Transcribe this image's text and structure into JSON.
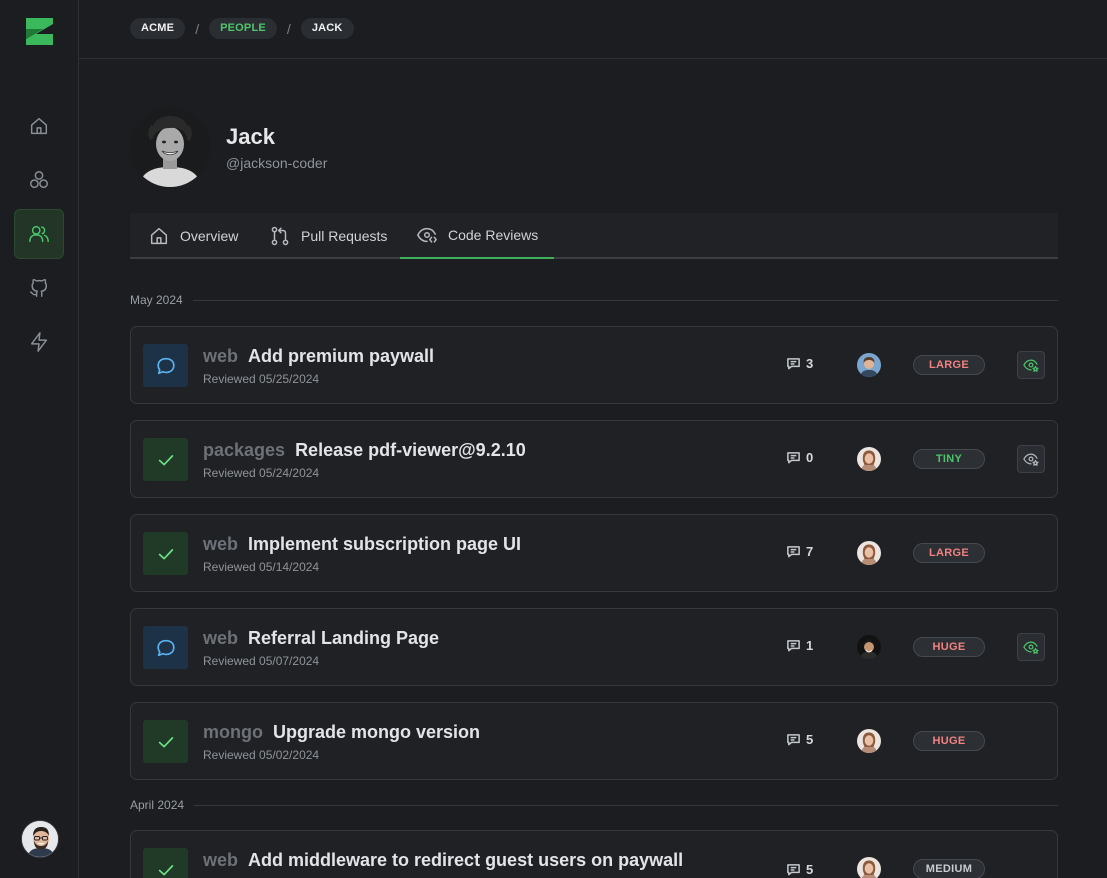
{
  "breadcrumb": [
    {
      "label": "ACME",
      "accent": false
    },
    {
      "label": "PEOPLE",
      "accent": true
    },
    {
      "label": "JACK",
      "accent": false
    }
  ],
  "breadcrumb_separator": "/",
  "profile": {
    "name": "Jack",
    "handle": "@jackson-coder"
  },
  "tabs": [
    {
      "label": "Overview",
      "icon": "home-icon",
      "active": false
    },
    {
      "label": "Pull Requests",
      "icon": "git-pull-request-icon",
      "active": false
    },
    {
      "label": "Code Reviews",
      "icon": "eye-code-icon",
      "active": true
    }
  ],
  "sidebar": {
    "items": [
      {
        "icon": "home-icon",
        "active": false
      },
      {
        "icon": "teams-icon",
        "active": false
      },
      {
        "icon": "people-icon",
        "active": true
      },
      {
        "icon": "github-icon",
        "active": false
      },
      {
        "icon": "lightning-icon",
        "active": false
      }
    ]
  },
  "months": [
    "May 2024",
    "April 2024"
  ],
  "reviews": [
    {
      "status": "commented",
      "repo": "web",
      "title": "Add premium paywall",
      "reviewed": "Reviewed 05/25/2024",
      "comments": "3",
      "size": "LARGE",
      "size_color": "#f08282",
      "watch": "active"
    },
    {
      "status": "approved",
      "repo": "packages",
      "title": "Release pdf-viewer@9.2.10",
      "reviewed": "Reviewed 05/24/2024",
      "comments": "0",
      "size": "TINY",
      "size_color": "#4cc76b",
      "watch": "inactive"
    },
    {
      "status": "approved",
      "repo": "web",
      "title": "Implement subscription page UI",
      "reviewed": "Reviewed 05/14/2024",
      "comments": "7",
      "size": "LARGE",
      "size_color": "#f08282",
      "watch": "none"
    },
    {
      "status": "commented",
      "repo": "web",
      "title": "Referral Landing Page",
      "reviewed": "Reviewed 05/07/2024",
      "comments": "1",
      "size": "HUGE",
      "size_color": "#f08282",
      "watch": "active"
    },
    {
      "status": "approved",
      "repo": "mongo",
      "title": "Upgrade mongo version",
      "reviewed": "Reviewed 05/02/2024",
      "comments": "5",
      "size": "HUGE",
      "size_color": "#f08282",
      "watch": "none"
    },
    {
      "status": "approved",
      "repo": "web",
      "title": "Add middleware to redirect guest users on paywall",
      "reviewed": "",
      "comments": "5",
      "size": "MEDIUM",
      "size_color": "#c8cbd0",
      "watch": "none"
    }
  ],
  "colors": {
    "accent": "#4cc76b",
    "comment_blue": "#5ab3f0",
    "danger": "#f08282"
  }
}
